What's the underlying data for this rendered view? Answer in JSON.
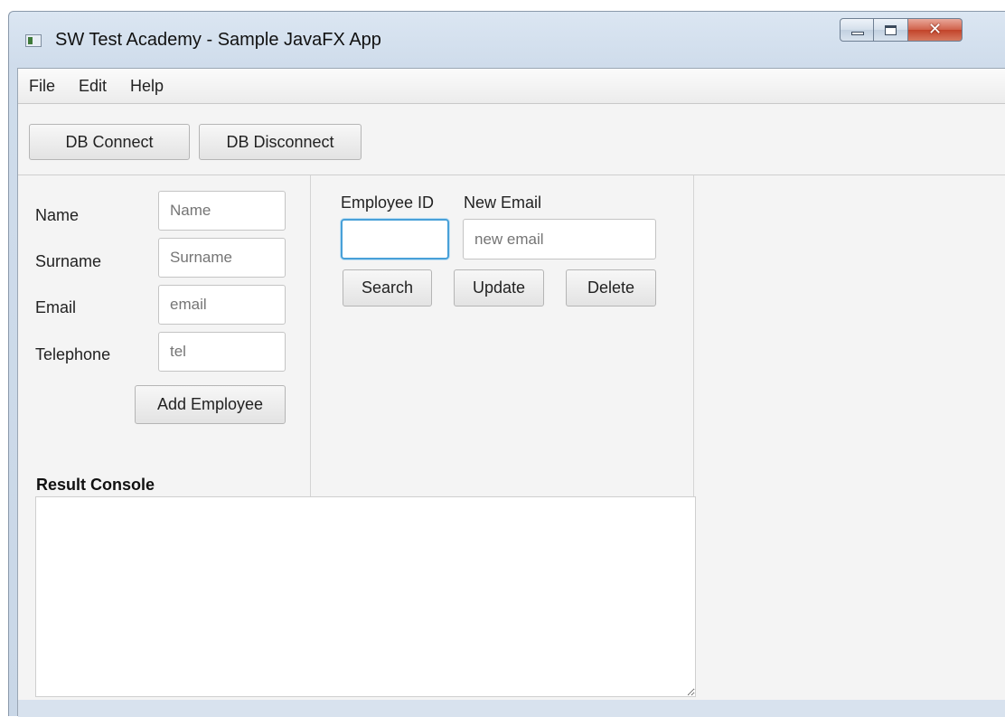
{
  "window": {
    "title": "SW Test Academy - Sample JavaFX App",
    "controls": {
      "minimize": "minimize-icon",
      "maximize": "maximize-icon",
      "close": "✕"
    }
  },
  "menubar": {
    "items": [
      "File",
      "Edit",
      "Help"
    ]
  },
  "toolbar": {
    "db_connect": "DB Connect",
    "db_disconnect": "DB Disconnect"
  },
  "add_form": {
    "name_label": "Name",
    "name_placeholder": "Name",
    "surname_label": "Surname",
    "surname_placeholder": "Surname",
    "email_label": "Email",
    "email_placeholder": "email",
    "telephone_label": "Telephone",
    "telephone_placeholder": "tel",
    "add_button": "Add Employee"
  },
  "search_panel": {
    "employee_id_label": "Employee ID",
    "employee_id_value": "",
    "new_email_label": "New Email",
    "new_email_placeholder": "new email",
    "search_button": "Search",
    "update_button": "Update",
    "delete_button": "Delete"
  },
  "console": {
    "label": "Result Console",
    "content": ""
  },
  "colors": {
    "focus_border": "#48a0d8",
    "close_button": "#c2432a"
  }
}
